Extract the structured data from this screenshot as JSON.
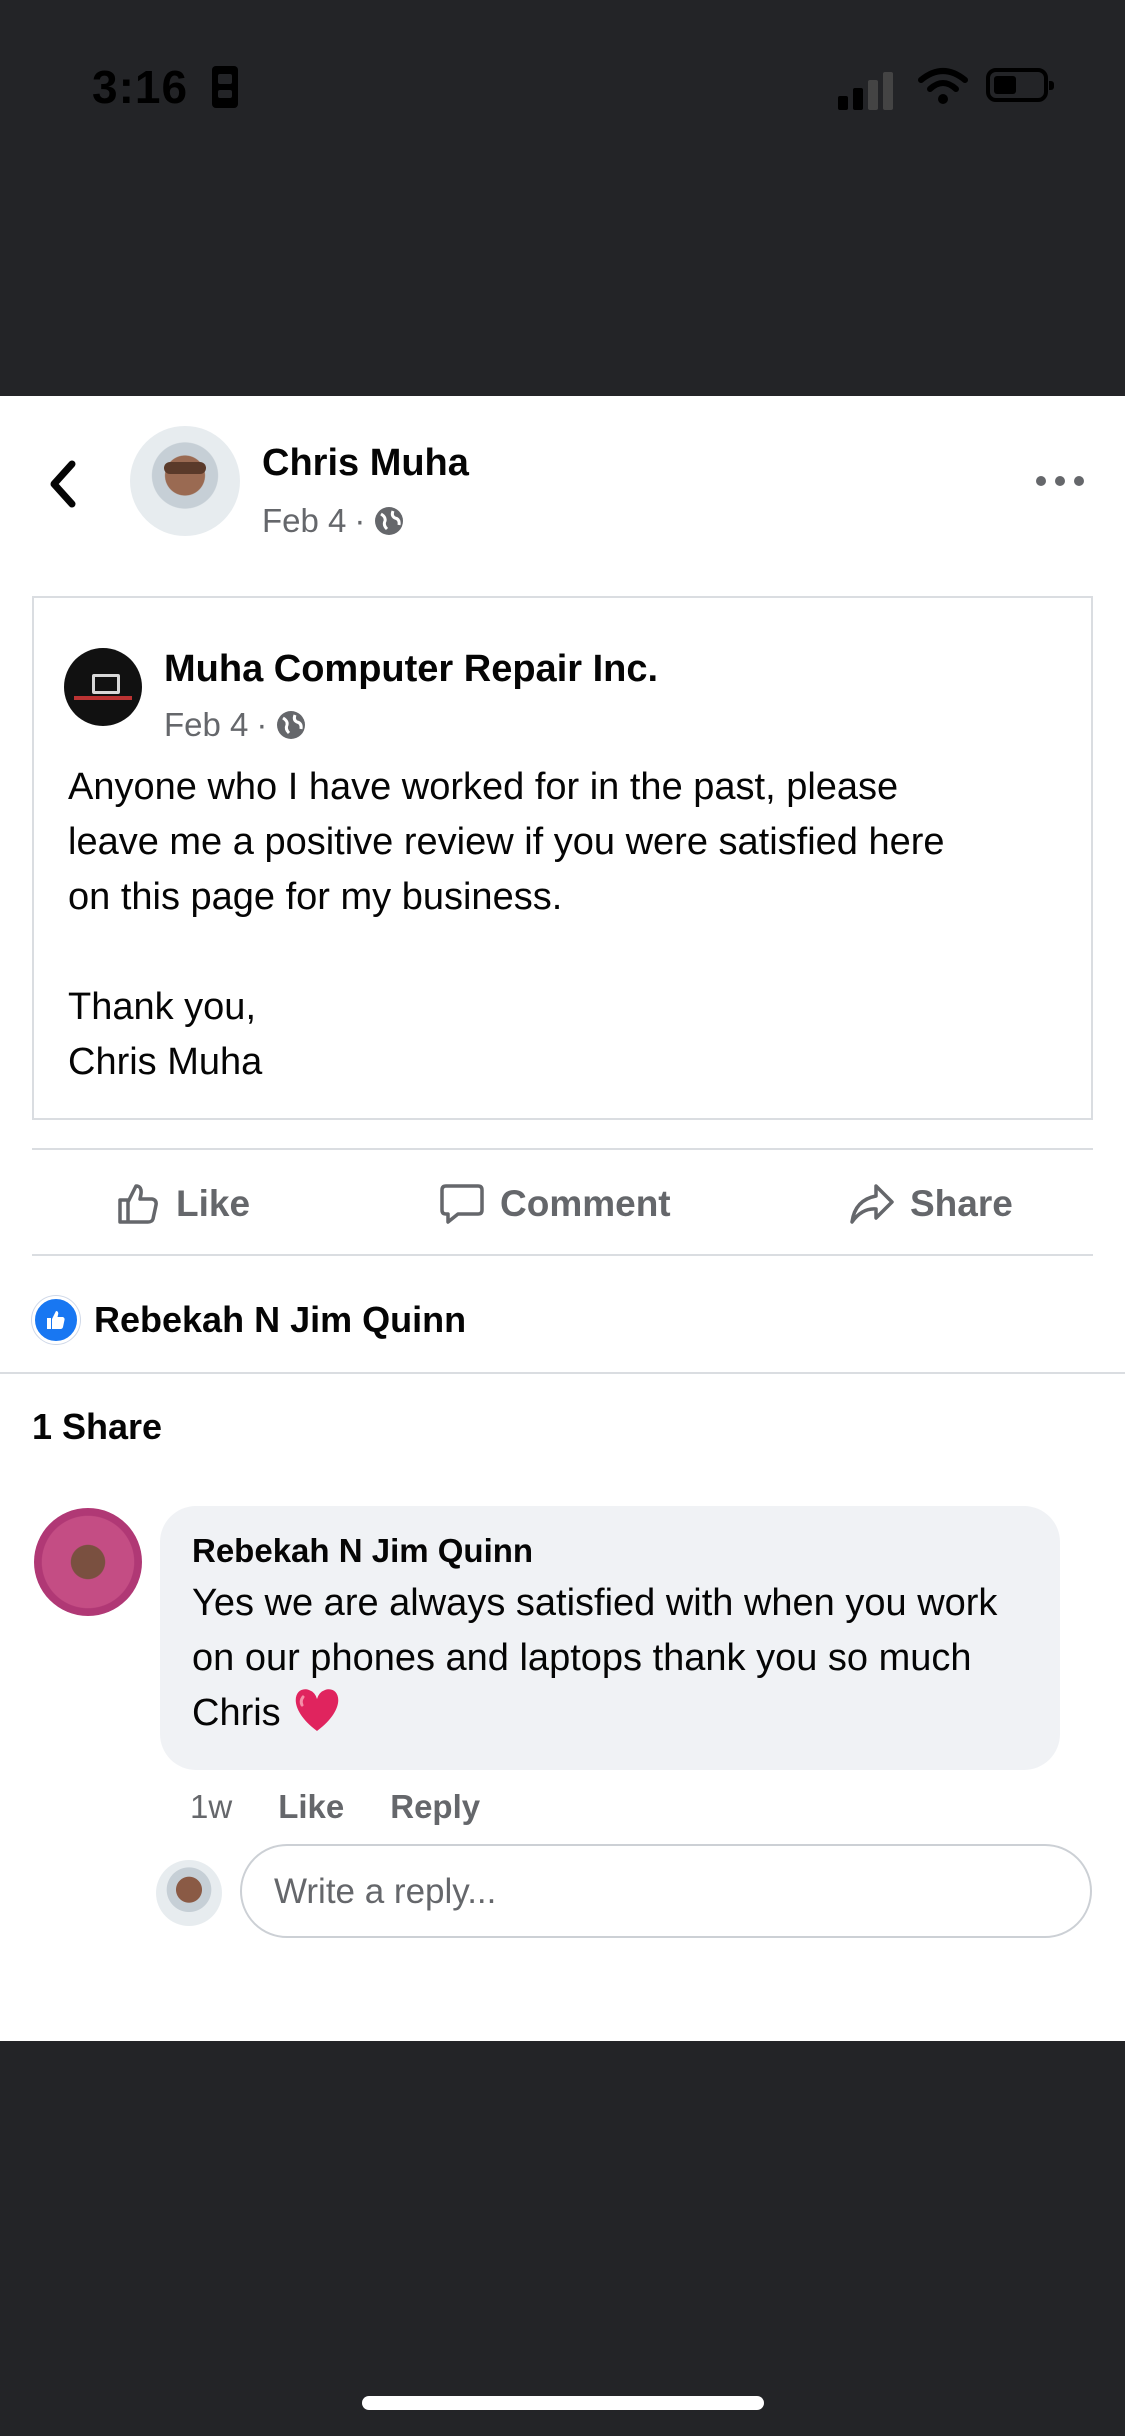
{
  "status_bar": {
    "time": "3:16"
  },
  "header": {
    "author_name": "Chris Muha",
    "date": "Feb 4",
    "separator": "·"
  },
  "shared_post": {
    "page_name": "Muha Computer Repair Inc.",
    "date": "Feb 4",
    "separator": "·",
    "text": "Anyone who I have worked for in the past, please\nleave me a positive review if you were satisfied here\non this page for my business.\n\nThank you,\nChris Muha"
  },
  "actions": {
    "like": "Like",
    "comment": "Comment",
    "share": "Share"
  },
  "reactions": {
    "names": "Rebekah N Jim Quinn"
  },
  "shares": {
    "label": "1 Share"
  },
  "comment": {
    "author": "Rebekah N Jim Quinn",
    "text": "Yes we are always satisfied with when you work on our phones and laptops thank you so much Chris",
    "age": "1w",
    "like": "Like",
    "reply": "Reply"
  },
  "reply_input": {
    "placeholder": "Write a reply..."
  },
  "colors": {
    "accent": "#1877f2",
    "secondary_text": "#65676b",
    "heart": "#e0245e"
  }
}
